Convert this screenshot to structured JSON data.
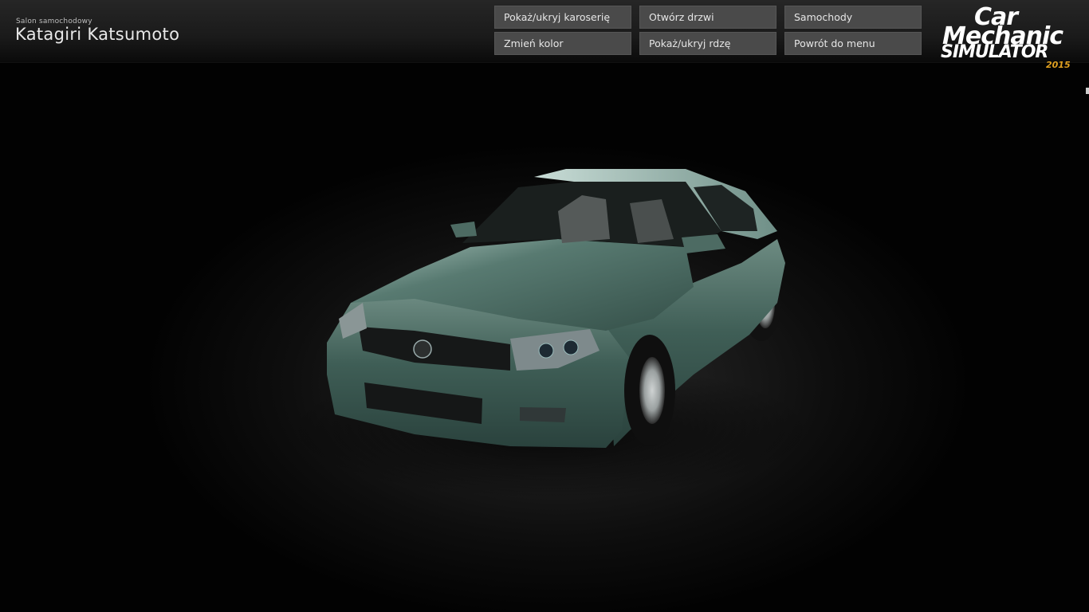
{
  "header": {
    "subtitle": "Salon samochodowy",
    "title": "Katagiri Katsumoto"
  },
  "menu": {
    "show_hide_body": "Pokaż/ukryj karoserię",
    "open_doors": "Otwórz drzwi",
    "cars": "Samochody",
    "change_color": "Zmień kolor",
    "show_hide_rust": "Pokaż/ukryj rdzę",
    "back_to_menu": "Powrót do menu"
  },
  "logo": {
    "line1": "Car",
    "line2": "Mechanic",
    "line3": "SIMULATOR",
    "year": "2015"
  },
  "colors": {
    "car_body": "#3f5e56",
    "button_bg": "#4a4a4a",
    "logo_year": "#e0a020"
  }
}
